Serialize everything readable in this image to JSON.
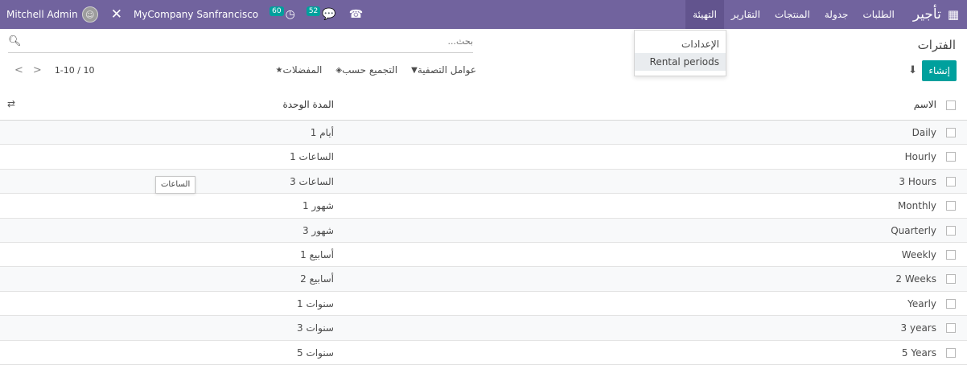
{
  "navbar": {
    "apps_icon": "grid-icon",
    "brand": "تأجير",
    "menus": [
      "الطلبات",
      "جدولة",
      "المنتجات",
      "التقارير",
      "التهيئة"
    ],
    "active_menu": "التهيئة",
    "user_name": "Mitchell Admin",
    "company": "MyCompany Sanfrancisco",
    "activity_count": "60",
    "messages_count": "52"
  },
  "dropdown": {
    "items": [
      "الإعدادات",
      "Rental periods"
    ]
  },
  "control_panel": {
    "title": "الفترات",
    "create_label": "إنشاء",
    "search_placeholder": "بحث...",
    "filters_label": "عوامل التصفية",
    "group_by_label": "التجميع حسب",
    "favorites_label": "المفضلات",
    "pager": "1-10 / 10"
  },
  "list": {
    "headers": {
      "name": "الاسم",
      "duration": "المدة الوحدة"
    },
    "rows": [
      {
        "name": "Daily",
        "duration": "1 أيام"
      },
      {
        "name": "Hourly",
        "duration": "1 الساعات"
      },
      {
        "name": "3 Hours",
        "duration": "3 الساعات"
      },
      {
        "name": "Monthly",
        "duration": "1 شهور"
      },
      {
        "name": "Quarterly",
        "duration": "3 شهور"
      },
      {
        "name": "Weekly",
        "duration": "1 أسابيع"
      },
      {
        "name": "2 Weeks",
        "duration": "2 أسابيع"
      },
      {
        "name": "Yearly",
        "duration": "1 سنوات"
      },
      {
        "name": "3 years",
        "duration": "3 سنوات"
      },
      {
        "name": "5 Years",
        "duration": "5 سنوات"
      }
    ]
  },
  "tooltip": "الساعات",
  "colors": {
    "navbar": "#71639e",
    "primary": "#00a09d"
  }
}
